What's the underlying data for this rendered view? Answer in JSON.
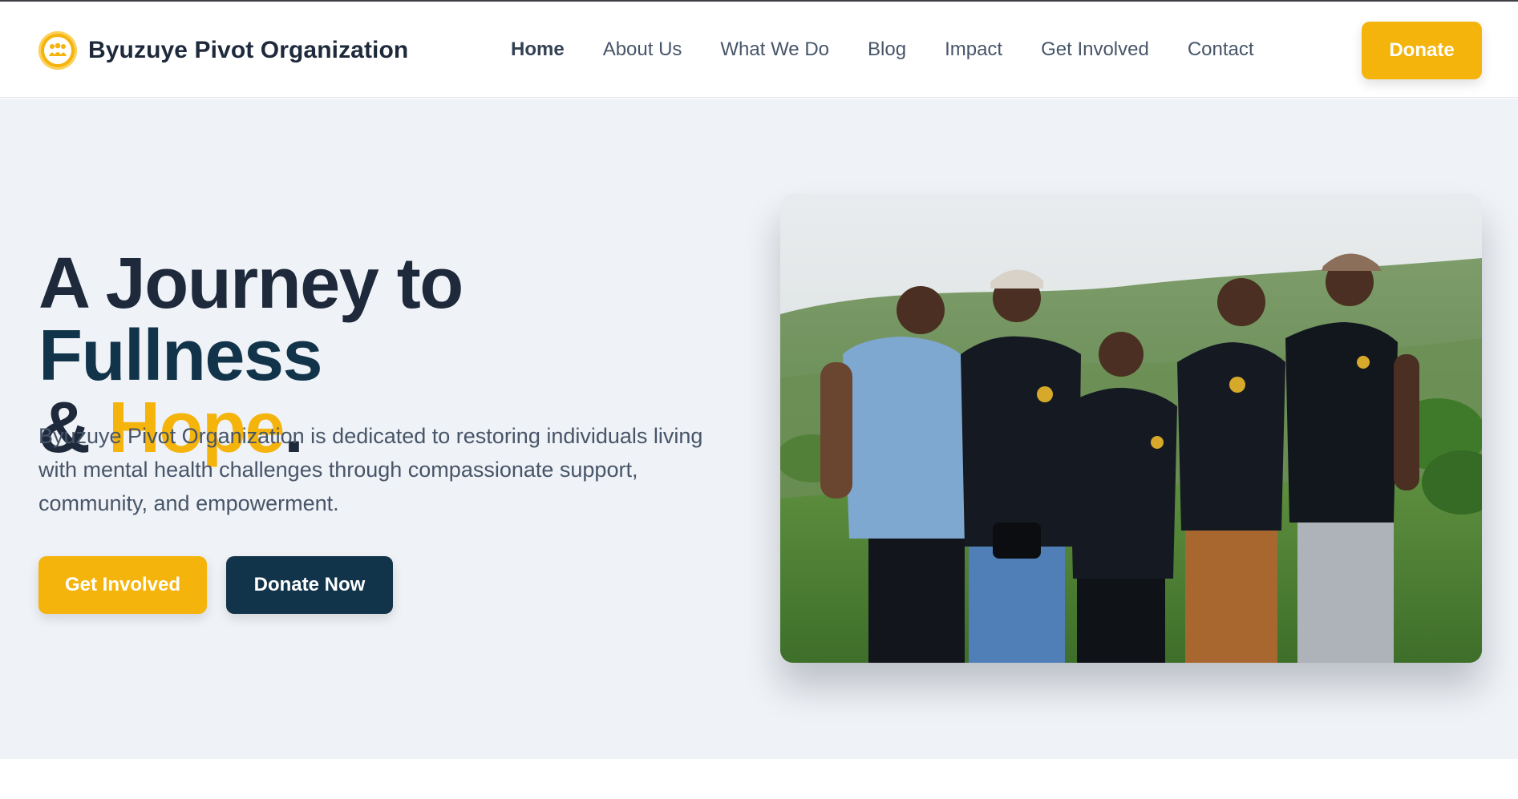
{
  "brand": {
    "name": "Byuzuye Pivot Organization",
    "logo_icon": "people-circle-logo-icon"
  },
  "nav": {
    "items": [
      {
        "label": "Home",
        "active": true
      },
      {
        "label": "About Us",
        "active": false
      },
      {
        "label": "What We Do",
        "active": false
      },
      {
        "label": "Blog",
        "active": false
      },
      {
        "label": "Impact",
        "active": false
      },
      {
        "label": "Get Involved",
        "active": false
      },
      {
        "label": "Contact",
        "active": false
      }
    ]
  },
  "header": {
    "donate_label": "Donate"
  },
  "hero": {
    "headline_part1": "A Journey to ",
    "headline_part2": "Fullness",
    "headline_part3": "& ",
    "headline_part4": "Hope",
    "headline_part5": ".",
    "description": "Byuzuye Pivot Organization is dedicated to restoring individuals living with mental health challenges through compassionate support, community, and empowerment.",
    "primary_button": "Get Involved",
    "secondary_button": "Donate Now"
  },
  "colors": {
    "accent": "#f5b40c",
    "navy": "#12344a",
    "hero_bg": "#eff2f6",
    "text": "#1e293b",
    "muted": "#475569"
  }
}
